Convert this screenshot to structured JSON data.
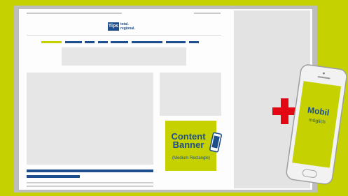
{
  "logo": {
    "mark": "Tips",
    "line1": "total.",
    "line2": "regional."
  },
  "banner": {
    "title_line1": "Content",
    "title_line2": "Banner",
    "subtitle": "(Medium Rectangle)"
  },
  "mobile": {
    "title": "Mobil",
    "subtitle": "möglich"
  },
  "colors": {
    "background": "#c5d100",
    "frame": "#bdbdbd",
    "accent_blue": "#1e4f8c",
    "plus_red": "#e30613",
    "placeholder_grey": "#e6e6e6"
  },
  "icons": [
    "smartphone-icon",
    "plus-icon"
  ]
}
